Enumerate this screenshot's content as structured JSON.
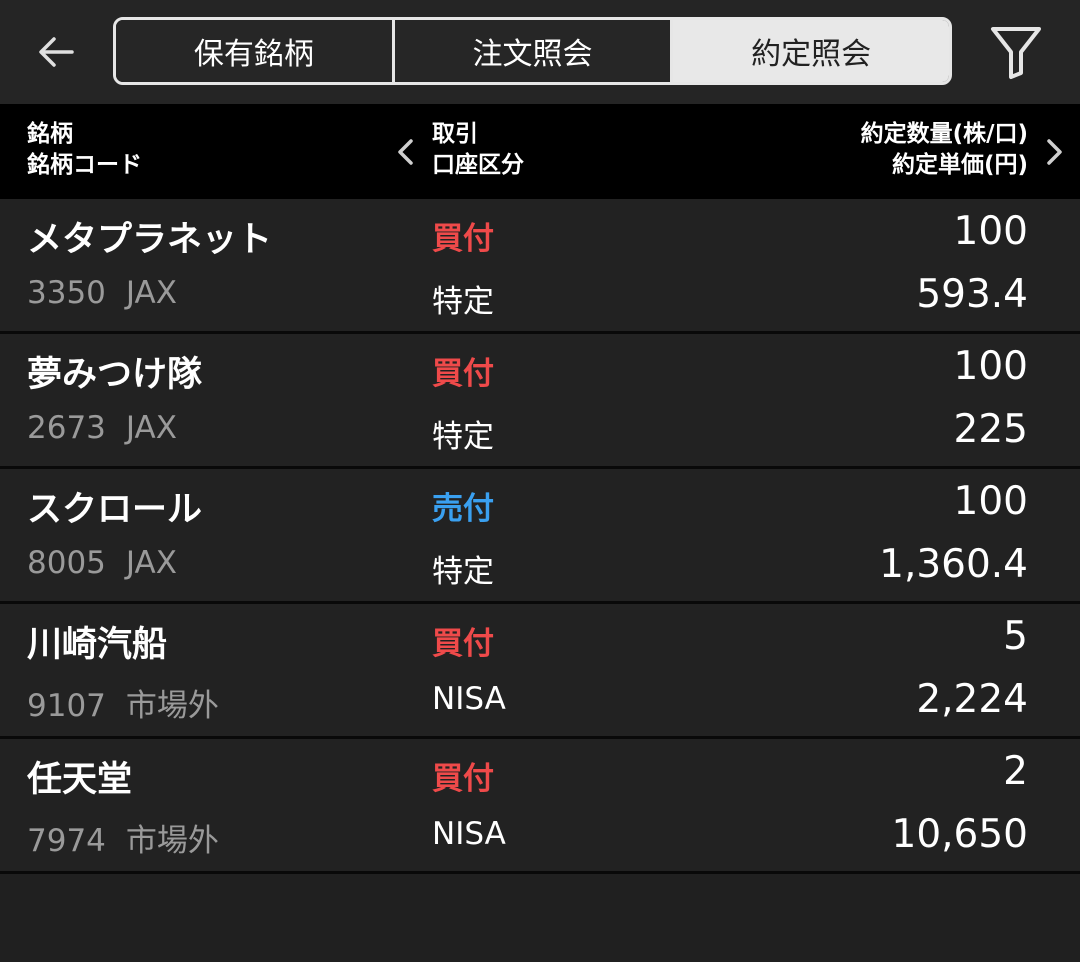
{
  "tabs": [
    {
      "label": "保有銘柄",
      "active": false
    },
    {
      "label": "注文照会",
      "active": false
    },
    {
      "label": "約定照会",
      "active": true
    }
  ],
  "header": {
    "col1_line1": "銘柄",
    "col1_line2": "銘柄コード",
    "col2_line1": "取引",
    "col2_line2": "口座区分",
    "col3_line1": "約定数量(株/口)",
    "col3_line2": "約定単価(円)"
  },
  "rows": [
    {
      "name": "メタプラネット",
      "code": "3350",
      "market": "JAX",
      "side": "買付",
      "side_type": "buy",
      "account": "特定",
      "qty": "100",
      "price": "593.4"
    },
    {
      "name": "夢みつけ隊",
      "code": "2673",
      "market": "JAX",
      "side": "買付",
      "side_type": "buy",
      "account": "特定",
      "qty": "100",
      "price": "225"
    },
    {
      "name": "スクロール",
      "code": "8005",
      "market": "JAX",
      "side": "売付",
      "side_type": "sell",
      "account": "特定",
      "qty": "100",
      "price": "1,360.4"
    },
    {
      "name": "川崎汽船",
      "code": "9107",
      "market": "市場外",
      "side": "買付",
      "side_type": "buy",
      "account": "NISA",
      "qty": "5",
      "price": "2,224"
    },
    {
      "name": "任天堂",
      "code": "7974",
      "market": "市場外",
      "side": "買付",
      "side_type": "buy",
      "account": "NISA",
      "qty": "2",
      "price": "10,650"
    }
  ],
  "icons": {
    "back": "arrow-left-icon",
    "filter": "filter-icon",
    "prev": "chevron-left-icon",
    "next": "chevron-right-icon"
  },
  "colors": {
    "buy": "#ef4a4a",
    "sell": "#3aa0f0",
    "background": "#202020",
    "header_background": "#000000"
  }
}
